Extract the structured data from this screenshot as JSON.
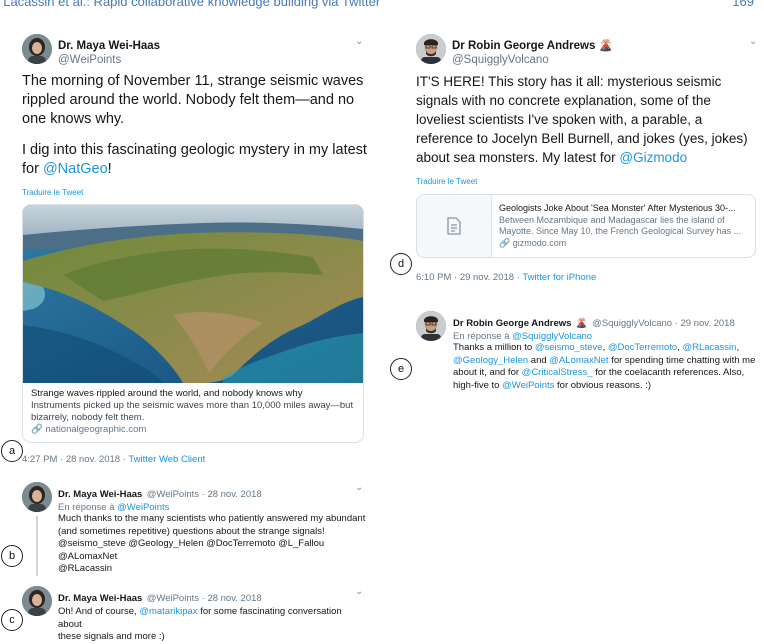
{
  "running_head": {
    "text": ". Lacassin et al.: Rapid collaborative knowledge building via Twitter",
    "page": "169"
  },
  "left_tweet": {
    "author": "Dr. Maya Wei-Haas",
    "handle": "@WeiPoints",
    "para1": "The morning of November 11, strange seismic waves rippled around the world. Nobody felt them—and no one knows why.",
    "para2_prefix": "I dig into this fascinating geologic mystery in my latest for",
    "para2_link": "@NatGeo",
    "para2_suffix": "!",
    "translate": "Traduire le Tweet",
    "card": {
      "title": "Strange waves rippled around the world, and nobody knows why",
      "description": "Instruments picked up the seismic waves more than 10,000 miles away—but bizarrely, nobody felt them.",
      "url": "nationalgeographic.com"
    },
    "time": "4:27 PM · 28 nov. 2018",
    "client": "Twitter Web Client"
  },
  "reply_b": {
    "author": "Dr. Maya Wei-Haas",
    "handle_date": "@WeiPoints · 28 nov. 2018",
    "in_reply_prefix": "En réponse à",
    "in_reply_to": "@WeiPoints",
    "text": "Much thanks to the many scientists who patiently answered my abundant (and sometimes repetitive) questions about the strange signals!",
    "mentions_line1": "@seismo_steve @Geology_Helen @DocTerremoto @L_Fallou @ALomaxNet",
    "mentions_line2": "@RLacassin"
  },
  "reply_c": {
    "author": "Dr. Maya Wei-Haas",
    "handle_date": "@WeiPoints · 28 nov. 2018",
    "text_prefix": "Oh! And of course,",
    "mention": "@matarikipax",
    "text_suffix": "for some fascinating conversation about",
    "text_line2": "these signals and more :)"
  },
  "right_tweet": {
    "author": "Dr Robin George Andrews",
    "author_emoji": "🌋",
    "handle": "@SquigglyVolcano",
    "text": "IT'S HERE! This story has it all: mysterious seismic signals with no concrete explanation, some of the loveliest scientists I've spoken with, a parable, a reference to Jocelyn Bell Burnell, and jokes (yes, jokes) about sea monsters. My latest for",
    "text_link": "@Gizmodo",
    "translate": "Traduire le Tweet",
    "card": {
      "title": "Geologists Joke About 'Sea Monster' After Mysterious 30-...",
      "description": "Between Mozambique and Madagascar lies the island of Mayotte. Since May 10, the French Geological Survey has ...",
      "url": "gizmodo.com"
    },
    "time": "6:10 PM · 29 nov. 2018",
    "client": "Twitter for iPhone"
  },
  "reply_e": {
    "author": "Dr Robin George Andrews",
    "author_emoji": "🌋",
    "handle_date": "@SquigglyVolcano · 29 nov. 2018",
    "in_reply_prefix": "En réponse à",
    "in_reply_to": "@SquigglyVolcano",
    "l1_prefix": "Thanks a million to",
    "l1_m1": "@seismo_steve",
    "l1_sep": ",",
    "l1_m2": "@DocTerremoto",
    "l1_m3": "@RLacassin",
    "l2_m1": "@Geology_Helen",
    "l2_and": "and",
    "l2_m2": "@ALomaxNet",
    "l2_suffix": "for spending time chatting with me",
    "l3_prefix": "about it, and for",
    "l3_m1": "@CriticalStress_",
    "l3_suffix": "for the coelacanth references. Also,",
    "l4_prefix": "high-five to",
    "l4_m1": "@WeiPoints",
    "l4_suffix": "for obvious reasons. :)"
  },
  "markers": [
    "a",
    "b",
    "c",
    "d",
    "e"
  ],
  "icons": {
    "chevron": "chevron-down-icon",
    "link": "link-icon",
    "document": "document-icon"
  },
  "colors": {
    "link": "#1b95e0",
    "muted": "#657786",
    "text": "#14171a",
    "running_head": "#4a78b6"
  }
}
